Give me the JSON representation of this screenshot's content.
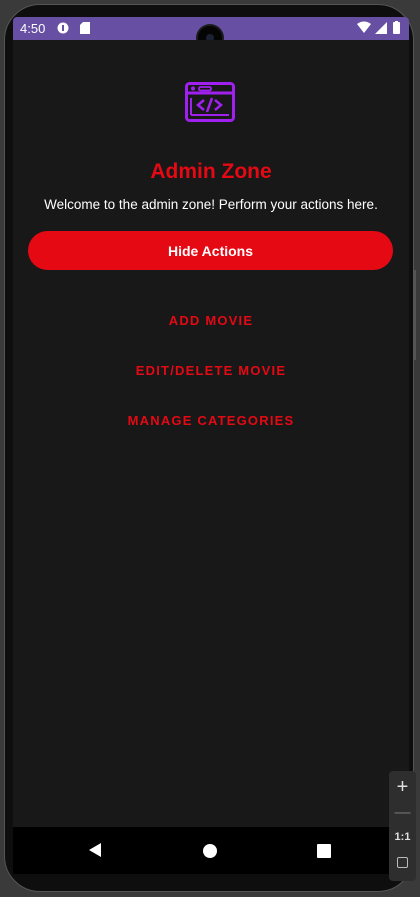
{
  "status_bar": {
    "time": "4:50",
    "color": "#6750a4"
  },
  "app": {
    "logo_icon": "code-window-icon",
    "title": "Admin Zone",
    "subtitle": "Welcome to the admin zone! Perform your actions here.",
    "primary_button": "Hide Actions",
    "actions": [
      {
        "label": "ADD MOVIE"
      },
      {
        "label": "EDIT/DELETE MOVIE"
      },
      {
        "label": "MANAGE CATEGORIES"
      }
    ],
    "accent_color": "#e50914",
    "background_color": "#181818"
  },
  "emulator_controls": {
    "zoom_label": "1:1"
  },
  "nav_bar": {
    "icons": [
      "back-icon",
      "home-icon",
      "recents-icon"
    ]
  }
}
